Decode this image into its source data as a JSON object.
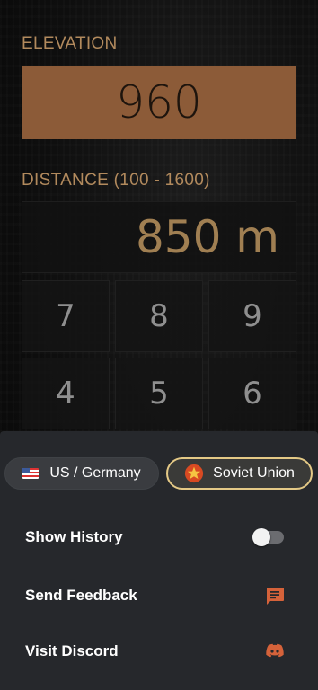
{
  "elevation": {
    "label": "ELEVATION",
    "value": "960"
  },
  "distance": {
    "label": "DISTANCE (100 - 1600)",
    "value": "850 m"
  },
  "keypad": {
    "keys": [
      "7",
      "8",
      "9",
      "4",
      "5",
      "6"
    ]
  },
  "sheet": {
    "factions": {
      "us_germany": {
        "label": "US / Germany",
        "icon": "us-flag-icon",
        "selected": false
      },
      "soviet_union": {
        "label": "Soviet Union",
        "icon": "soviet-star-icon",
        "selected": true
      }
    },
    "show_history": {
      "label": "Show History",
      "enabled": false
    },
    "send_feedback": {
      "label": "Send Feedback",
      "icon": "feedback-icon"
    },
    "visit_discord": {
      "label": "Visit Discord",
      "icon": "discord-icon"
    }
  },
  "colors": {
    "accent_brown": "#8c5b38",
    "label_gold": "#b28a5d",
    "selected_border": "#e4c986",
    "icon_orange": "#d5623a",
    "sheet_bg": "#26282c"
  }
}
